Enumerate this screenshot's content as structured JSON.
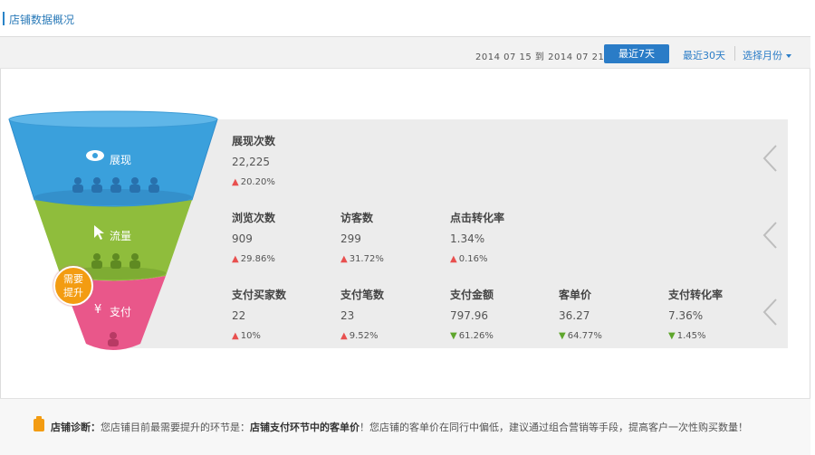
{
  "header": {
    "title": "店铺数据概况"
  },
  "toolbar": {
    "date_range": "2014 07 15 到 2014 07 21",
    "btn_7days": "最近7天",
    "btn_30days": "最近30天",
    "month_select": "选择月份"
  },
  "funnel": {
    "stage1": "展现",
    "stage2": "流量",
    "stage3": "支付",
    "badge": [
      "需要",
      "提升"
    ],
    "colors": {
      "stage1": "#3aa0dc",
      "stage2": "#8fbd3c",
      "stage3": "#e9578a",
      "badge": "#f39c12"
    }
  },
  "rows": [
    {
      "metrics": [
        {
          "label": "展现次数",
          "value": "22,225",
          "change": "20.20%",
          "dir": "up"
        }
      ]
    },
    {
      "metrics": [
        {
          "label": "浏览次数",
          "value": "909",
          "change": "29.86%",
          "dir": "up"
        },
        {
          "label": "访客数",
          "value": "299",
          "change": "31.72%",
          "dir": "up"
        },
        {
          "label": "点击转化率",
          "value": "1.34%",
          "change": "0.16%",
          "dir": "up"
        }
      ]
    },
    {
      "metrics": [
        {
          "label": "支付买家数",
          "value": "22",
          "change": "10%",
          "dir": "up"
        },
        {
          "label": "支付笔数",
          "value": "23",
          "change": "9.52%",
          "dir": "up"
        },
        {
          "label": "支付金额",
          "value": "797.96",
          "change": "61.26%",
          "dir": "down"
        },
        {
          "label": "客单价",
          "value": "36.27",
          "change": "64.77%",
          "dir": "down"
        },
        {
          "label": "支付转化率",
          "value": "7.36%",
          "change": "1.45%",
          "dir": "down"
        }
      ]
    }
  ],
  "diagnosis": {
    "label": "店铺诊断：",
    "text1": "您店铺目前最需要提升的环节是：",
    "highlight": "店铺支付环节中的客单价",
    "text2": "！您店铺的客单价在同行中偏低，建议通过组合营销等手段，提高客户一次性购买数量！"
  }
}
